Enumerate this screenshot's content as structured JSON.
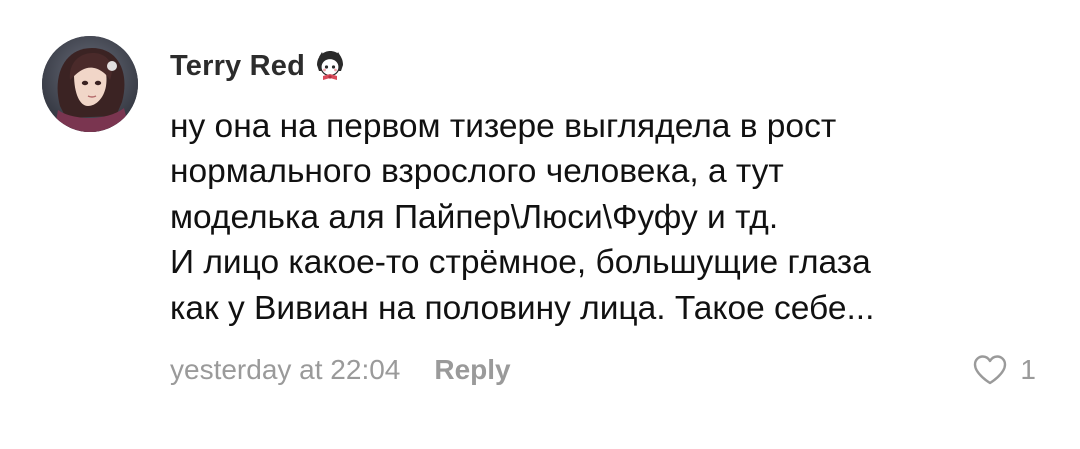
{
  "comment": {
    "author": "Terry Red",
    "author_badge_icon": "character-sticker-icon",
    "text": "ну она на первом тизере выглядела в рост\nнормального взрослого человека, а тут\nмоделька аля Пайпер\\Люси\\Фуфу и тд.\nИ лицо какое-то стрёмное, большущие глаза\nкак у Вивиан на половину лица. Такое себе...",
    "timestamp": "yesterday at 22:04",
    "reply_label": "Reply",
    "like_count": "1",
    "like_icon": "heart-outline-icon"
  },
  "colors": {
    "text": "#111111",
    "muted": "#9a9a9a",
    "background": "#ffffff"
  }
}
